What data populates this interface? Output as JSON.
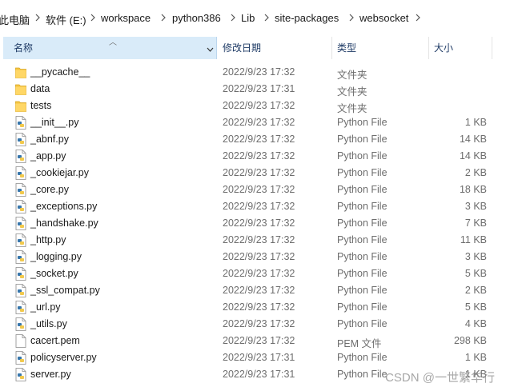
{
  "breadcrumb": [
    "此电脑",
    "软件 (E:)",
    "workspace",
    "python386",
    "Lib",
    "site-packages",
    "websocket"
  ],
  "columns": {
    "name": "名称",
    "date": "修改日期",
    "type": "类型",
    "size": "大小"
  },
  "files": [
    {
      "name": "__pycache__",
      "date": "2022/9/23 17:32",
      "type": "文件夹",
      "size": "",
      "kind": "folder"
    },
    {
      "name": "data",
      "date": "2022/9/23 17:31",
      "type": "文件夹",
      "size": "",
      "kind": "folder"
    },
    {
      "name": "tests",
      "date": "2022/9/23 17:32",
      "type": "文件夹",
      "size": "",
      "kind": "folder"
    },
    {
      "name": "__init__.py",
      "date": "2022/9/23 17:32",
      "type": "Python File",
      "size": "1 KB",
      "kind": "py"
    },
    {
      "name": "_abnf.py",
      "date": "2022/9/23 17:32",
      "type": "Python File",
      "size": "14 KB",
      "kind": "py"
    },
    {
      "name": "_app.py",
      "date": "2022/9/23 17:32",
      "type": "Python File",
      "size": "14 KB",
      "kind": "py"
    },
    {
      "name": "_cookiejar.py",
      "date": "2022/9/23 17:32",
      "type": "Python File",
      "size": "2 KB",
      "kind": "py"
    },
    {
      "name": "_core.py",
      "date": "2022/9/23 17:32",
      "type": "Python File",
      "size": "18 KB",
      "kind": "py"
    },
    {
      "name": "_exceptions.py",
      "date": "2022/9/23 17:32",
      "type": "Python File",
      "size": "3 KB",
      "kind": "py"
    },
    {
      "name": "_handshake.py",
      "date": "2022/9/23 17:32",
      "type": "Python File",
      "size": "7 KB",
      "kind": "py"
    },
    {
      "name": "_http.py",
      "date": "2022/9/23 17:32",
      "type": "Python File",
      "size": "11 KB",
      "kind": "py"
    },
    {
      "name": "_logging.py",
      "date": "2022/9/23 17:32",
      "type": "Python File",
      "size": "3 KB",
      "kind": "py"
    },
    {
      "name": "_socket.py",
      "date": "2022/9/23 17:32",
      "type": "Python File",
      "size": "5 KB",
      "kind": "py"
    },
    {
      "name": "_ssl_compat.py",
      "date": "2022/9/23 17:32",
      "type": "Python File",
      "size": "2 KB",
      "kind": "py"
    },
    {
      "name": "_url.py",
      "date": "2022/9/23 17:32",
      "type": "Python File",
      "size": "5 KB",
      "kind": "py"
    },
    {
      "name": "_utils.py",
      "date": "2022/9/23 17:32",
      "type": "Python File",
      "size": "4 KB",
      "kind": "py"
    },
    {
      "name": "cacert.pem",
      "date": "2022/9/23 17:32",
      "type": "PEM 文件",
      "size": "298 KB",
      "kind": "pem"
    },
    {
      "name": "policyserver.py",
      "date": "2022/9/23 17:31",
      "type": "Python File",
      "size": "1 KB",
      "kind": "py"
    },
    {
      "name": "server.py",
      "date": "2022/9/23 17:31",
      "type": "Python File",
      "size": "1 KB",
      "kind": "py"
    }
  ],
  "watermark": "CSDN @一世繁华行",
  "colors": {
    "header_selected": "#d9ebf9",
    "folder": "#f5c542",
    "python_blue": "#3776ab"
  }
}
